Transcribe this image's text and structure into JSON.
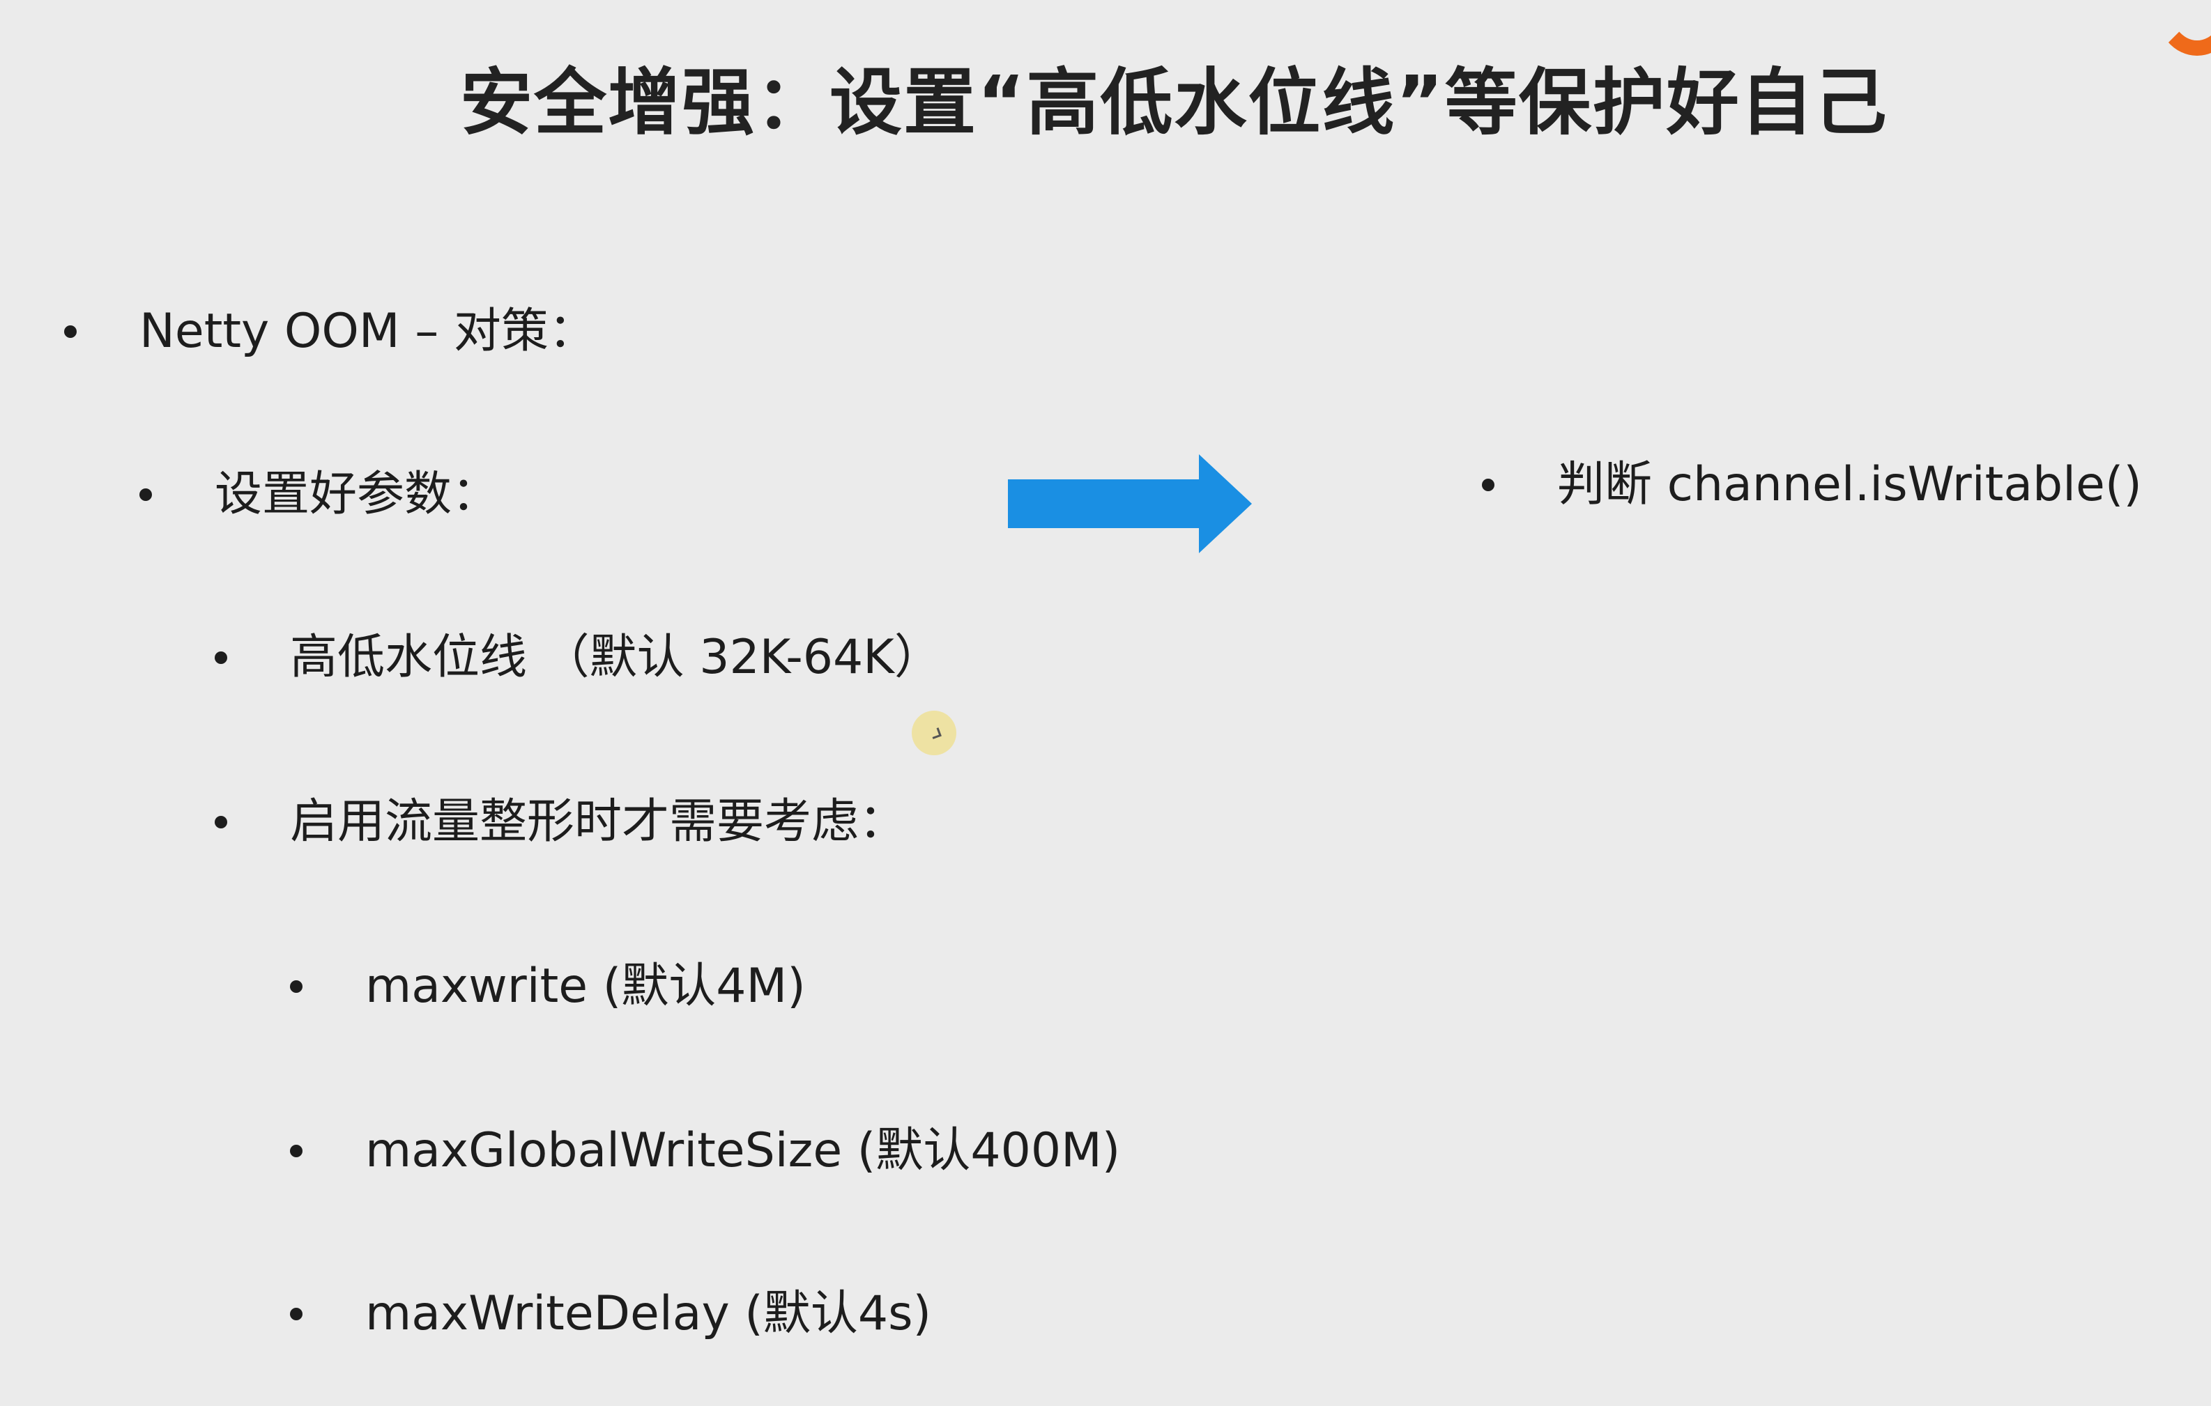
{
  "slide": {
    "title": "安全增强：设置“高低水位线”等保护好自己",
    "bullets": {
      "b1": "Netty OOM – 对策：",
      "b2": "设置好参数：",
      "b3": "高低水位线 （默认 32K-64K）",
      "b4": "启用流量整形时才需要考虑：",
      "b5": "maxwrite (默认4M)",
      "b6": "maxGlobalWriteSize (默认400M)",
      "b7": "maxWriteDelay (默认4s)",
      "right": "判断 channel.isWritable()"
    }
  },
  "colors": {
    "background": "#ebebeb",
    "arrow": "#1a8fe3",
    "logo": "#ef6a1a"
  },
  "icons": {
    "arrow": "right-arrow-icon",
    "logo": "brand-logo-icon",
    "cursor": "mouse-cursor-icon"
  }
}
